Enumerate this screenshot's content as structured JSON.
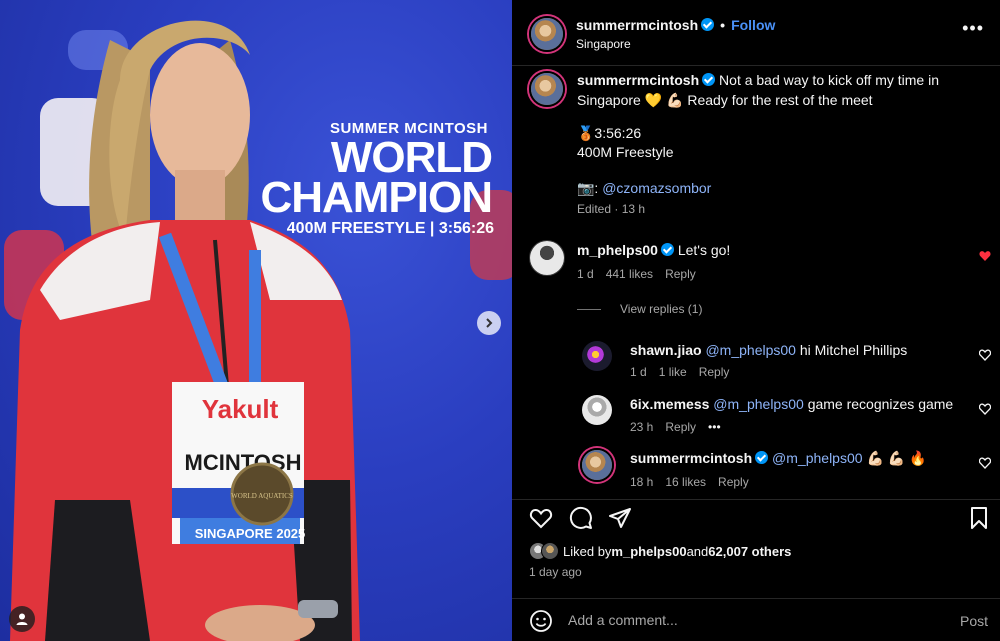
{
  "media": {
    "overlay_name": "SUMMER MCINTOSH",
    "overlay_title_1": "WORLD",
    "overlay_title_2": "CHAMPION",
    "overlay_event": "400M FREESTYLE | 3:56:26",
    "bib_sponsor": "Yakult",
    "bib_name": "MCINTOSH",
    "bib_location": "SINGAPORE 2025",
    "medal_text": "WORLD AQUATICS"
  },
  "header": {
    "username": "summerrmcintosh",
    "separator": "•",
    "follow_label": "Follow",
    "location": "Singapore",
    "more_label": "•••"
  },
  "caption": {
    "username": "summerrmcintosh",
    "line1": "Not a bad way to kick off my time in",
    "line2": "Singapore 💛 💪🏻 Ready for the rest of the meet",
    "time_line": "🥉3:56:26",
    "event_line": "400M Freestyle",
    "photo_credit_prefix": "📷: ",
    "photo_credit": "@czomazsombor",
    "edited": "Edited · 13 h"
  },
  "comments": [
    {
      "username": "m_phelps00",
      "verified": true,
      "text": "Let's go!",
      "age": "1 d",
      "likes": "441 likes",
      "reply": "Reply",
      "liked": true,
      "view_replies": "View replies (1)"
    },
    {
      "username": "shawn.jiao",
      "mention": "@m_phelps00",
      "text": "hi Mitchel Phillips",
      "age": "1 d",
      "likes": "1 like",
      "reply": "Reply"
    },
    {
      "username": "6ix.memess",
      "mention": "@m_phelps00",
      "text": "game recognizes game",
      "age": "23 h",
      "reply": "Reply",
      "more": "•••"
    },
    {
      "username": "summerrmcintosh",
      "verified": true,
      "mention": "@m_phelps00",
      "text": "💪🏻 💪🏻 🔥",
      "age": "18 h",
      "likes": "16 likes",
      "reply": "Reply"
    }
  ],
  "likes": {
    "prefix": "Liked by ",
    "user": "m_phelps00",
    "middle": " and ",
    "others": "62,007 others"
  },
  "time_ago": "1 day ago",
  "add_comment": {
    "placeholder": "Add a comment...",
    "post_label": "Post"
  },
  "colors": {
    "accent_link": "#4a91f7",
    "mention": "#8eb4f8",
    "like_red": "#ff3040",
    "verified": "#0095f6"
  }
}
